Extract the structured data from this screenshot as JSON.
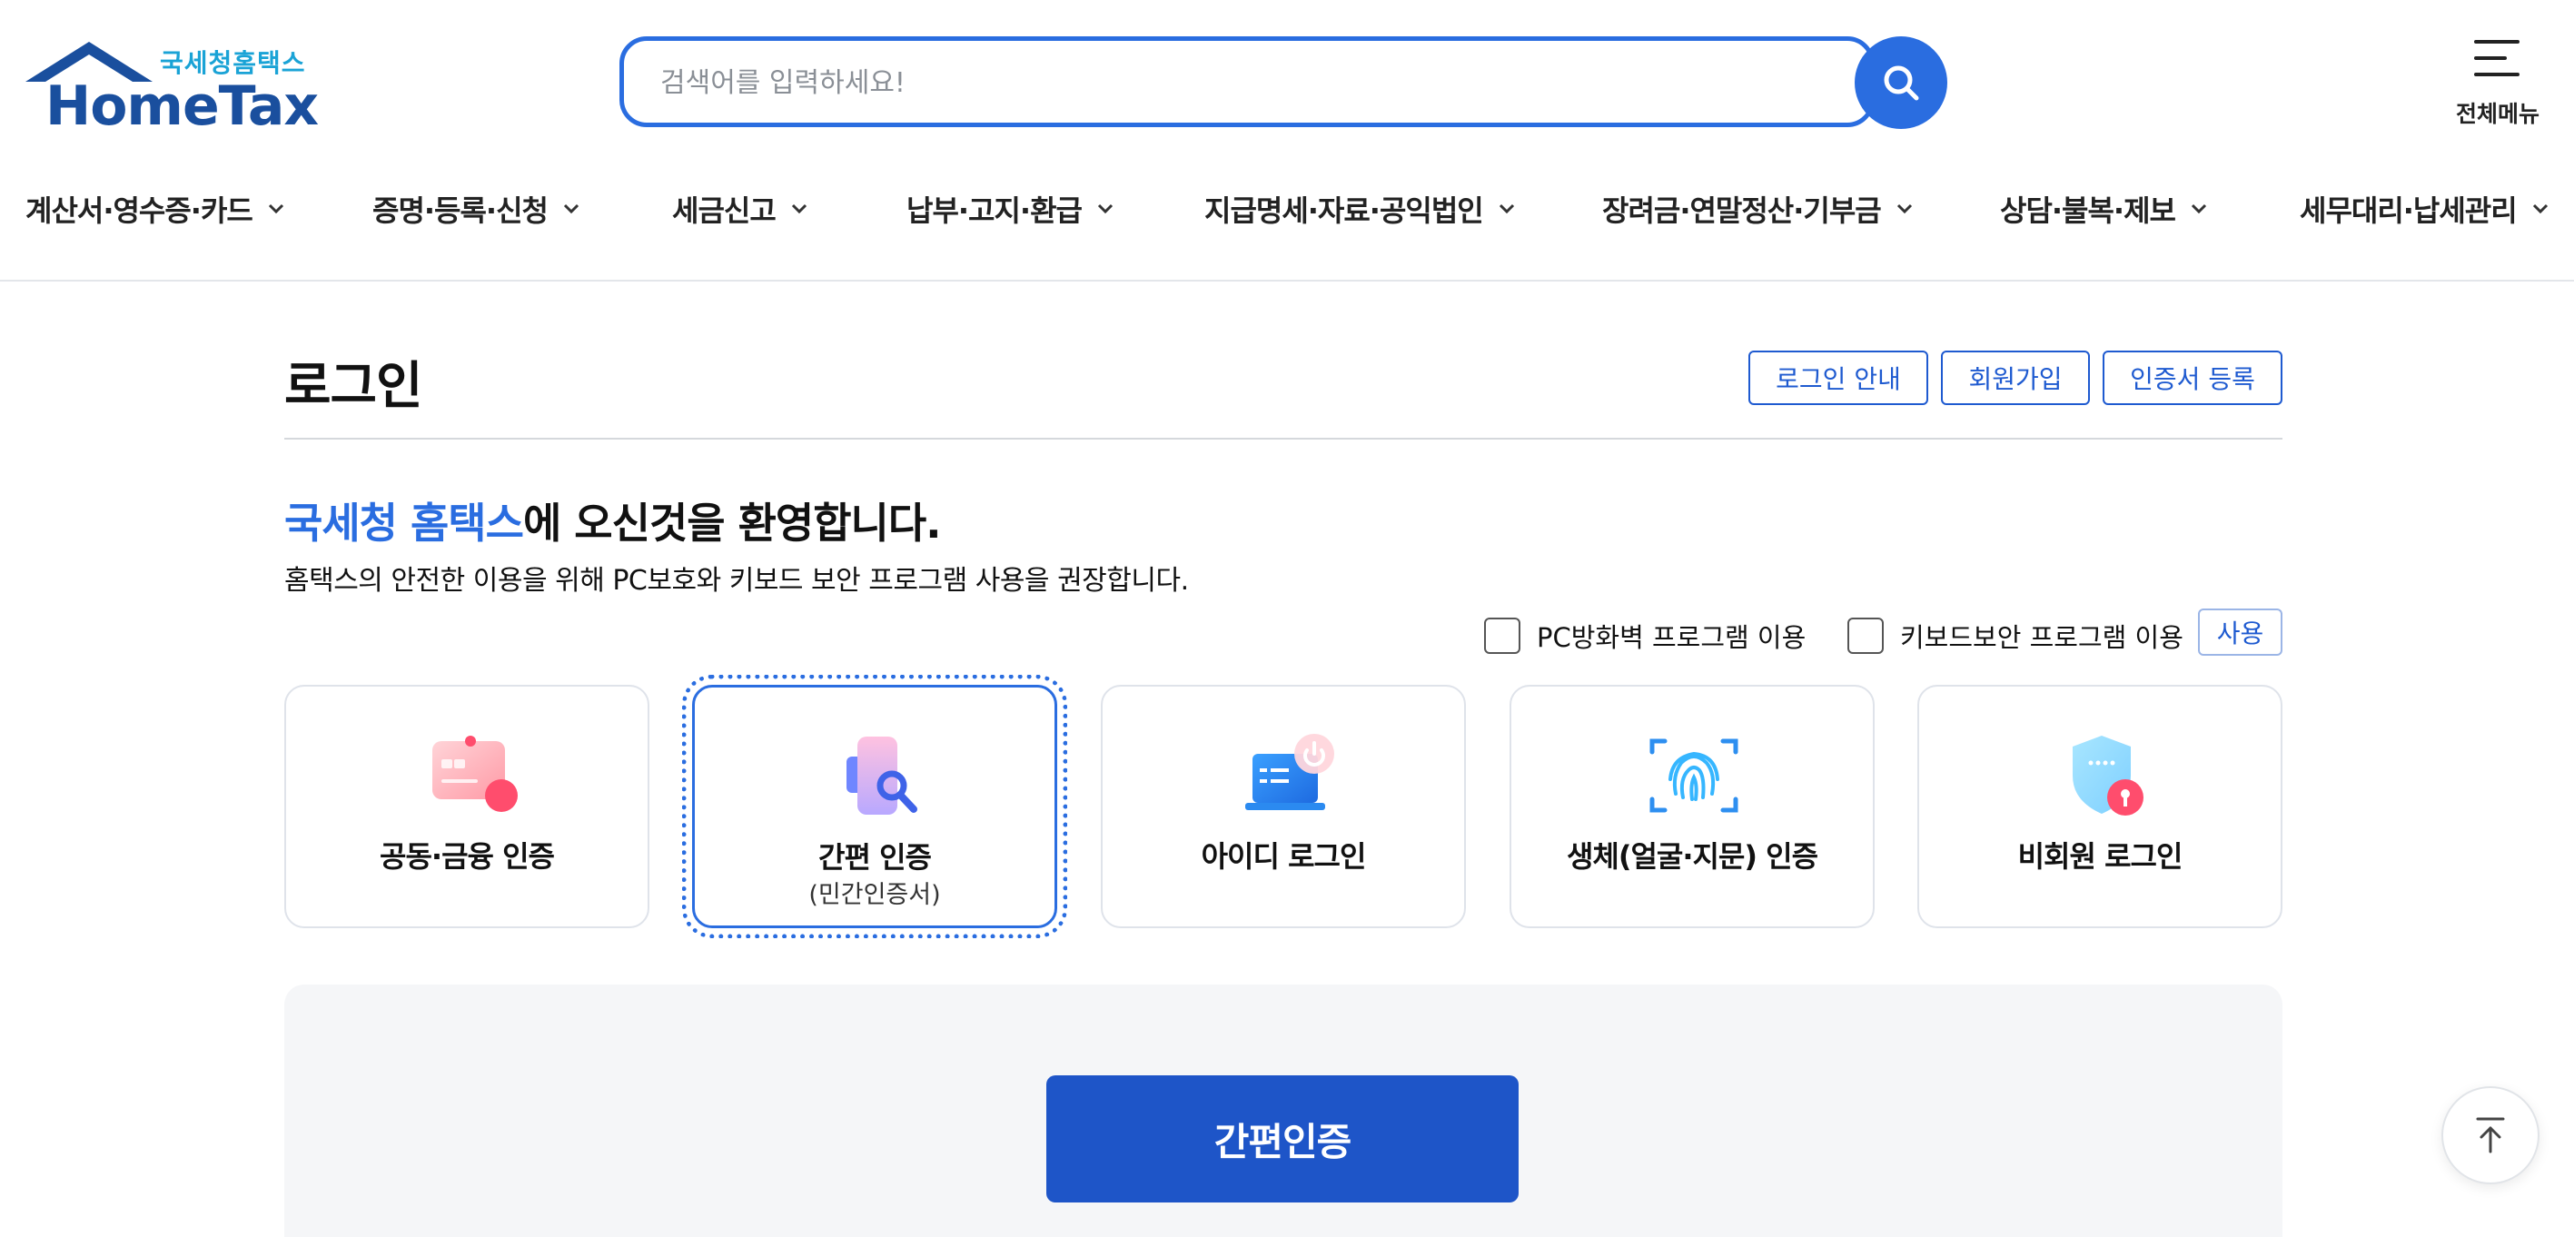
{
  "header": {
    "logo_sub": "국세청홈택스",
    "logo_main": "HomeTax",
    "search_placeholder": "검색어를 입력하세요!",
    "allmenu_label": "전체메뉴",
    "colors": {
      "primary": "#2a6de0",
      "logo": "#1a4f9e",
      "logo_sub": "#1aa3d6"
    }
  },
  "nav": [
    "계산서·영수증·카드",
    "증명·등록·신청",
    "세금신고",
    "납부·고지·환급",
    "지급명세·자료·공익법인",
    "장려금·연말정산·기부금",
    "상담·불복·제보",
    "세무대리·납세관리"
  ],
  "page": {
    "title": "로그인",
    "buttons": {
      "login_guide": "로그인 안내",
      "signup": "회원가입",
      "cert_register": "인증서 등록"
    },
    "welcome_highlight": "국세청 홈택스",
    "welcome_rest": "에 오신것을 환영합니다.",
    "description": "홈택스의 안전한 이용을 위해 PC보호와 키보드 보안 프로그램 사용을 권장합니다.",
    "options": {
      "firewall": "PC방화벽 프로그램 이용",
      "keyboard": "키보드보안 프로그램 이용",
      "use_button": "사용"
    },
    "methods": [
      {
        "label": "공동·금융 인증",
        "sub": "",
        "icon": "certificate-card-icon"
      },
      {
        "label": "간편 인증",
        "sub": "(민간인증서)",
        "icon": "simple-auth-phone-icon"
      },
      {
        "label": "아이디 로그인",
        "sub": "",
        "icon": "laptop-power-icon"
      },
      {
        "label": "생체(얼굴·지문) 인증",
        "sub": "",
        "icon": "fingerprint-icon"
      },
      {
        "label": "비회원 로그인",
        "sub": "",
        "icon": "shield-lock-icon"
      }
    ],
    "selected_method": 1,
    "primary_action": "간편인증"
  }
}
